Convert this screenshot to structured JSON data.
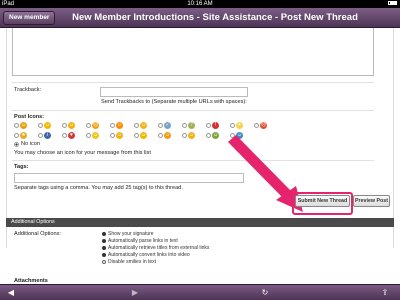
{
  "status": {
    "device": "iPad",
    "time": "10:16 AM"
  },
  "nav": {
    "back_label": "New member",
    "title": "New Member Introductions - Site Assistance - Post New Thread"
  },
  "trackback": {
    "label": "Trackback:",
    "hint": "Send Trackbacks to (Separate multiple URLs with spaces):"
  },
  "post_icons": {
    "label": "Post Icons:",
    "none_label": "No icon",
    "hint": "You may choose an icon for your message from this list",
    "icons": [
      {
        "name": "smile-icon",
        "color": "#e8a00f",
        "glyph": "☺"
      },
      {
        "name": "wink-icon",
        "color": "#f5b800",
        "glyph": "☺"
      },
      {
        "name": "grin-icon",
        "color": "#f2b10b",
        "glyph": "☺"
      },
      {
        "name": "sad-icon",
        "color": "#f2a10a",
        "glyph": "☹"
      },
      {
        "name": "mad-icon",
        "color": "#ff8a00",
        "glyph": "☺"
      },
      {
        "name": "cool-icon",
        "color": "#f4b41a",
        "glyph": "☺"
      },
      {
        "name": "thumbs-up-icon",
        "color": "#7aa2c2",
        "glyph": "✓"
      },
      {
        "name": "question-icon",
        "color": "#9fb25a",
        "glyph": "?"
      },
      {
        "name": "exclaim-icon",
        "color": "#d33131",
        "glyph": "!"
      },
      {
        "name": "lightbulb-icon",
        "color": "#f7d24a",
        "glyph": "✦"
      },
      {
        "name": "angry-icon",
        "color": "#e24c2d",
        "glyph": "☹"
      },
      {
        "name": "star-icon",
        "color": "#e3aa24",
        "glyph": "★"
      },
      {
        "name": "info-icon",
        "color": "#4169a6",
        "glyph": "i"
      },
      {
        "name": "love-icon",
        "color": "#cf3b3b",
        "glyph": "♥"
      },
      {
        "name": "happy-icon",
        "color": "#f0c41e",
        "glyph": "☺"
      },
      {
        "name": "shock-icon",
        "color": "#efb40c",
        "glyph": "☺"
      },
      {
        "name": "laugh-icon",
        "color": "#f4b600",
        "glyph": "☺"
      },
      {
        "name": "blush-icon",
        "color": "#ef9b13",
        "glyph": "☺"
      },
      {
        "name": "tongue-icon",
        "color": "#f0b20f",
        "glyph": "☺"
      },
      {
        "name": "confused-icon",
        "color": "#7ea440",
        "glyph": "☺"
      },
      {
        "name": "wave-icon",
        "color": "#3b8ac3",
        "glyph": "☺"
      }
    ]
  },
  "tags": {
    "label": "Tags:",
    "hint": "Separate tags using a comma. You may add 25 tag(s) to this thread."
  },
  "actions": {
    "submit_label": "Submit New Thread",
    "preview_label": "Preview Post"
  },
  "additional": {
    "header": "Additional Options",
    "label": "Additional Options:",
    "options": [
      {
        "label": "Show your signature",
        "checked": true
      },
      {
        "label": "Automatically parse links in text",
        "checked": true
      },
      {
        "label": "Automatically retrieve titles from external links",
        "checked": true
      },
      {
        "label": "Automatically convert links into video",
        "checked": true
      },
      {
        "label": "Disable smilies in text",
        "checked": false
      }
    ],
    "attachments_label": "Attachments"
  },
  "colors": {
    "nav": "#5f4468",
    "highlight": "#e6246e"
  }
}
